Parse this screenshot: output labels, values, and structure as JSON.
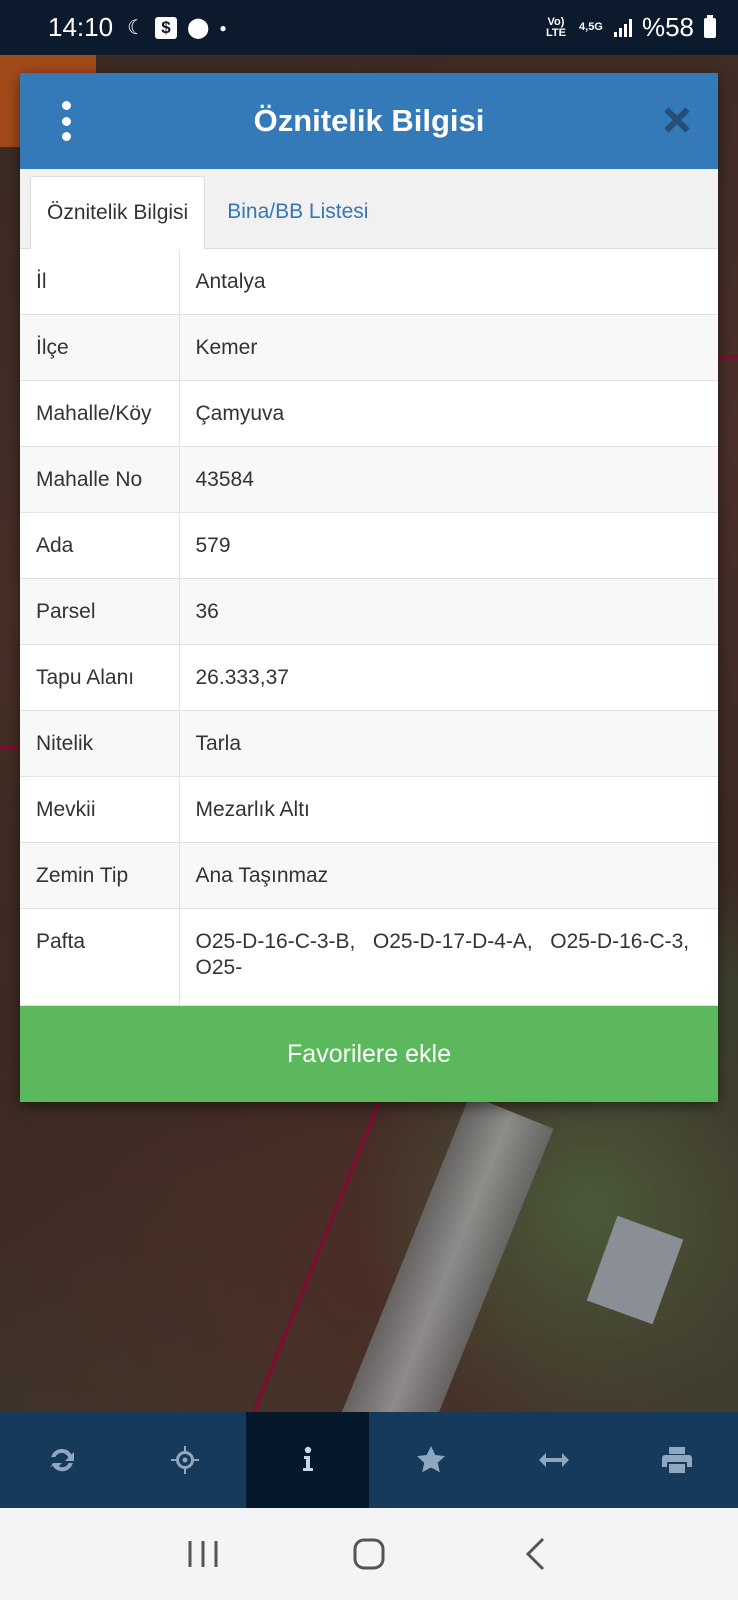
{
  "status_bar": {
    "time": "14:10",
    "network": "Vo) LTE",
    "network_speed": "4,5G",
    "battery": "%58"
  },
  "dialog": {
    "title": "Öznitelik Bilgisi",
    "tabs": [
      {
        "label": "Öznitelik Bilgisi",
        "active": true
      },
      {
        "label": "Bina/BB Listesi",
        "active": false
      }
    ],
    "rows": [
      {
        "key": "İl",
        "value": "Antalya"
      },
      {
        "key": "İlçe",
        "value": "Kemer"
      },
      {
        "key": "Mahalle/Köy",
        "value": "Çamyuva"
      },
      {
        "key": "Mahalle No",
        "value": "43584"
      },
      {
        "key": "Ada",
        "value": "579"
      },
      {
        "key": "Parsel",
        "value": "36"
      },
      {
        "key": "Tapu Alanı",
        "value": "26.333,37"
      },
      {
        "key": "Nitelik",
        "value": "Tarla"
      },
      {
        "key": "Mevkii",
        "value": "Mezarlık Altı"
      },
      {
        "key": "Zemin Tip",
        "value": "Ana Taşınmaz"
      },
      {
        "key": "Pafta",
        "value": "O25-D-16-C-3-B,   O25-D-17-D-4-A,   O25-D-16-C-3, O25-"
      }
    ],
    "favorite_button": "Favorilere ekle"
  },
  "toolbar": {
    "items": [
      "refresh-icon",
      "crosshair-icon",
      "info-icon",
      "star-icon",
      "arrows-horizontal-icon",
      "print-icon"
    ],
    "active_index": 2
  },
  "colors": {
    "header": "#357ab8",
    "favorite_button": "#5cb85c",
    "toolbar": "#163a5c",
    "toolbar_active": "#06192c",
    "tab_link": "#3576b5"
  }
}
